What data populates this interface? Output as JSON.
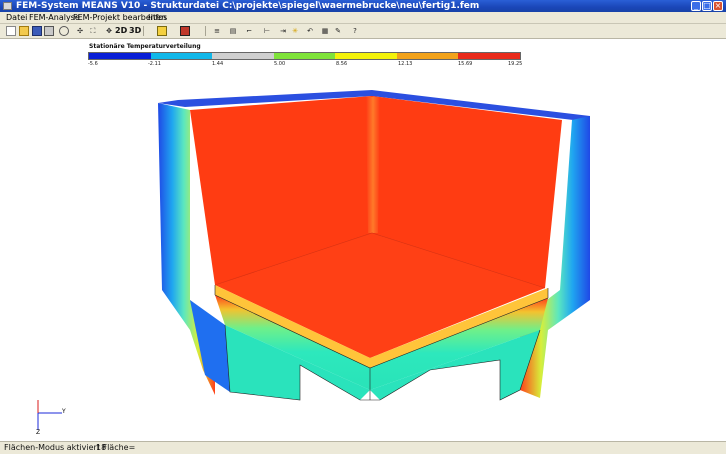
{
  "window": {
    "title": "FEM-System MEANS V10  -  Strukturdatei C:\\projekte\\spiegel\\waermebrucke\\neu\\fertig1.fem"
  },
  "menu": {
    "items": [
      "Datei",
      "FEM-Analyse",
      "FEM-Projekt bearbeiten",
      "Infos"
    ]
  },
  "toolbar": {
    "buttons": [
      {
        "icon": "new-file-icon"
      },
      {
        "icon": "open-folder-icon"
      },
      {
        "icon": "save-icon"
      },
      {
        "icon": "print-icon"
      },
      {
        "icon": "zoom-icon"
      },
      {
        "icon": "zoom-extents-icon"
      },
      {
        "icon": "zoom-window-icon"
      },
      {
        "icon": "move-icon"
      },
      {
        "icon": "view-2d-text",
        "label": "2D"
      },
      {
        "icon": "view-3d-text",
        "label": "3D"
      },
      {
        "icon": "cube-icon"
      },
      {
        "icon": "render-icon"
      },
      {
        "icon": "list-icon"
      },
      {
        "icon": "edit-icon"
      },
      {
        "icon": "arrow-icon"
      },
      {
        "icon": "support-icon"
      },
      {
        "icon": "load-icon"
      },
      {
        "icon": "light-icon"
      },
      {
        "icon": "rotate-icon"
      },
      {
        "icon": "grid-icon"
      },
      {
        "icon": "pen-icon"
      },
      {
        "icon": "help-icon"
      }
    ]
  },
  "legend": {
    "title": "Stationäre Temperaturverteilung",
    "colors": [
      "#0a1fd6",
      "#11b7e9",
      "#cfcfcf",
      "#7fe33a",
      "#f4f20a",
      "#f2a21a",
      "#e82a1a"
    ],
    "labels": [
      "-5.6",
      "-2.11",
      "1.44",
      "5.00",
      "8.56",
      "12.13",
      "15.69",
      "19.25"
    ]
  },
  "axes": {
    "y_label": "Y",
    "z_label": "Z"
  },
  "status": {
    "text": "Flächen-Modus aktiviert  Fläche=",
    "value": "18"
  },
  "colors": {
    "titlebar": "#1f4fc4",
    "chrome": "#ece9d8",
    "hot": "#ff3b14",
    "cold": "#2a3ad9",
    "cool": "#27e0b9"
  }
}
